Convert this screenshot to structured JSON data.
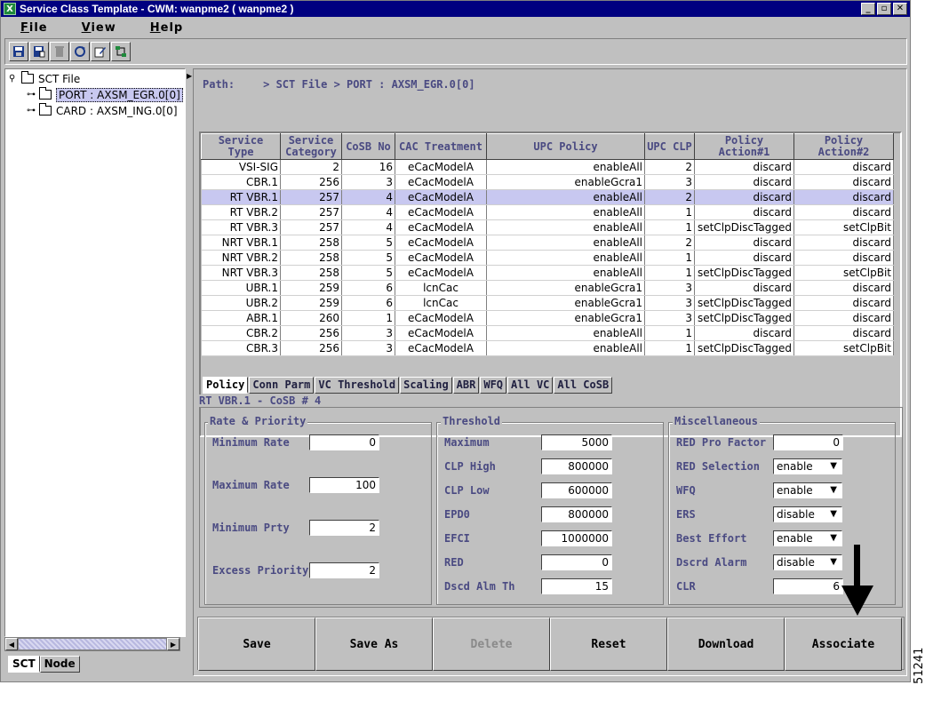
{
  "window": {
    "title": "Service Class Template - CWM: wanpme2 ( wanpme2 )",
    "controls": [
      "_",
      "▫",
      "✕"
    ]
  },
  "menu": [
    {
      "label": "File",
      "key": "F",
      "rest": "ile"
    },
    {
      "label": "View",
      "key": "V",
      "rest": "iew"
    },
    {
      "label": "Help",
      "key": "H",
      "rest": "elp"
    }
  ],
  "toolbar": {
    "icons": [
      "save-icon",
      "save-as-icon",
      "delete-icon",
      "refresh-icon",
      "edit-icon",
      "network-icon"
    ]
  },
  "tree": {
    "root": "SCT File",
    "items": [
      {
        "label": "PORT : AXSM_EGR.0[0]",
        "selected": true
      },
      {
        "label": "CARD : AXSM_ING.0[0]",
        "selected": false
      }
    ]
  },
  "left_tabs": [
    "SCT",
    "Node"
  ],
  "path": {
    "label": "Path:",
    "value": "> SCT File > PORT : AXSM_EGR.0[0]"
  },
  "table": {
    "columns": [
      "Service Type",
      "Service Category",
      "CoSB No",
      "CAC Treatment",
      "UPC Policy",
      "UPC CLP",
      "Policy Action#1",
      "Policy Action#2"
    ],
    "rows": [
      [
        "VSI-SIG",
        "2",
        "16",
        "eCacModelA",
        "enableAll",
        "2",
        "discard",
        "discard"
      ],
      [
        "CBR.1",
        "256",
        "3",
        "eCacModelA",
        "enableGcra1",
        "3",
        "discard",
        "discard"
      ],
      [
        "RT VBR.1",
        "257",
        "4",
        "eCacModelA",
        "enableAll",
        "2",
        "discard",
        "discard"
      ],
      [
        "RT VBR.2",
        "257",
        "4",
        "eCacModelA",
        "enableAll",
        "1",
        "discard",
        "discard"
      ],
      [
        "RT VBR.3",
        "257",
        "4",
        "eCacModelA",
        "enableAll",
        "1",
        "setClpDiscTagged",
        "setClpBit"
      ],
      [
        "NRT VBR.1",
        "258",
        "5",
        "eCacModelA",
        "enableAll",
        "2",
        "discard",
        "discard"
      ],
      [
        "NRT VBR.2",
        "258",
        "5",
        "eCacModelA",
        "enableAll",
        "1",
        "discard",
        "discard"
      ],
      [
        "NRT VBR.3",
        "258",
        "5",
        "eCacModelA",
        "enableAll",
        "1",
        "setClpDiscTagged",
        "setClpBit"
      ],
      [
        "UBR.1",
        "259",
        "6",
        "lcnCac",
        "enableGcra1",
        "3",
        "discard",
        "discard"
      ],
      [
        "UBR.2",
        "259",
        "6",
        "lcnCac",
        "enableGcra1",
        "3",
        "setClpDiscTagged",
        "discard"
      ],
      [
        "ABR.1",
        "260",
        "1",
        "eCacModelA",
        "enableGcra1",
        "3",
        "setClpDiscTagged",
        "discard"
      ],
      [
        "CBR.2",
        "256",
        "3",
        "eCacModelA",
        "enableAll",
        "1",
        "discard",
        "discard"
      ],
      [
        "CBR.3",
        "256",
        "3",
        "eCacModelA",
        "enableAll",
        "1",
        "setClpDiscTagged",
        "setClpBit"
      ]
    ],
    "selected_row": 2
  },
  "tabs": [
    "Policy",
    "Conn Parm",
    "VC Threshold",
    "Scaling",
    "ABR",
    "WFQ",
    "All VC",
    "All CoSB"
  ],
  "active_tab": "Policy",
  "detail": {
    "title": "RT VBR.1 - CoSB # 4",
    "rate_priority": {
      "title": "Rate & Priority",
      "fields": [
        {
          "label": "Minimum Rate",
          "value": "0"
        },
        {
          "label": "Maximum Rate",
          "value": "100"
        },
        {
          "label": "Minimum Prty",
          "value": "2"
        },
        {
          "label": "Excess Priority",
          "value": "2"
        }
      ]
    },
    "threshold": {
      "title": "Threshold",
      "fields": [
        {
          "label": "Maximum",
          "value": "5000"
        },
        {
          "label": "CLP High",
          "value": "800000"
        },
        {
          "label": "CLP Low",
          "value": "600000"
        },
        {
          "label": "EPD0",
          "value": "800000"
        },
        {
          "label": "EFCI",
          "value": "1000000"
        },
        {
          "label": "RED",
          "value": "0"
        },
        {
          "label": "Dscd Alm Th",
          "value": "15"
        }
      ]
    },
    "misc": {
      "title": "Miscellaneous",
      "fields": [
        {
          "label": "RED Pro Factor",
          "value": "0",
          "kind": "input"
        },
        {
          "label": "RED Selection",
          "value": "enable",
          "kind": "select"
        },
        {
          "label": "WFQ",
          "value": "enable",
          "kind": "select"
        },
        {
          "label": "ERS",
          "value": "disable",
          "kind": "select"
        },
        {
          "label": "Best Effort",
          "value": "enable",
          "kind": "select"
        },
        {
          "label": "Dscrd Alarm",
          "value": "disable",
          "kind": "select"
        },
        {
          "label": "CLR",
          "value": "6",
          "kind": "input"
        }
      ]
    }
  },
  "actions": [
    {
      "label": "Save",
      "enabled": true
    },
    {
      "label": "Save As",
      "enabled": true
    },
    {
      "label": "Delete",
      "enabled": false
    },
    {
      "label": "Reset",
      "enabled": true
    },
    {
      "label": "Download",
      "enabled": true
    },
    {
      "label": "Associate",
      "enabled": true
    }
  ],
  "figure_id": "51241"
}
